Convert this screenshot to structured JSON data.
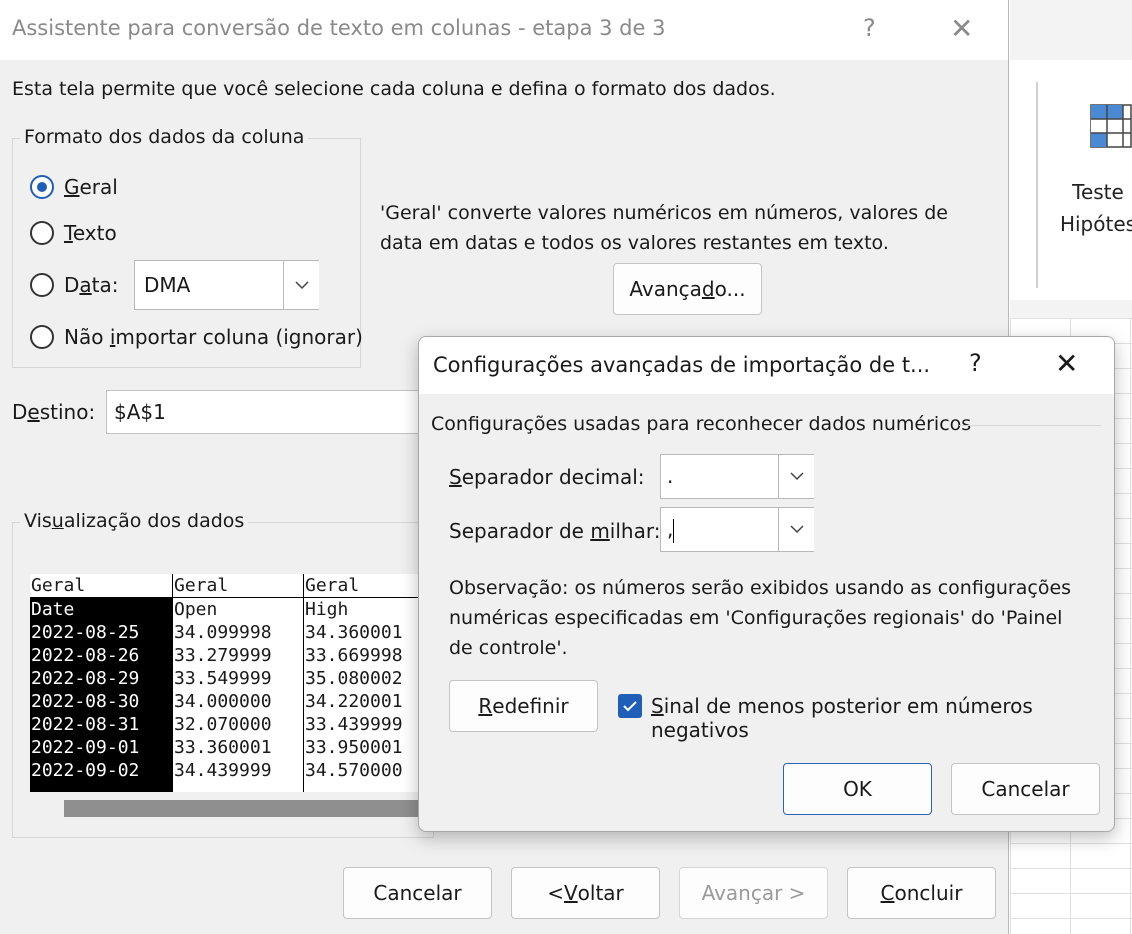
{
  "wizard": {
    "title": "Assistente para conversão de texto em colunas - etapa 3 de 3",
    "help_icon": "?",
    "close_icon": "✕",
    "intro": "Esta tela permite que você selecione cada coluna e defina o formato dos dados.",
    "format_group": {
      "legend": "Formato dos dados da coluna",
      "options": {
        "geral": {
          "pre": "",
          "mn": "G",
          "post": "eral",
          "checked": true
        },
        "texto": {
          "pre": "",
          "mn": "T",
          "post": "exto",
          "checked": false
        },
        "data": {
          "pre": "D",
          "mn": "a",
          "post": "ta:",
          "checked": false
        },
        "ignore": {
          "pre": "Não ",
          "mn": "i",
          "post": "mportar coluna (ignorar)",
          "checked": false
        }
      },
      "date_combo_value": "DMA"
    },
    "description": "'Geral' converte valores numéricos em números, valores de data em datas e todos os valores restantes em texto.",
    "advanced_button": {
      "pre": "Avança",
      "mn": "d",
      "post": "o..."
    },
    "destination": {
      "pre": "D",
      "mn": "e",
      "post": "stino:",
      "value": "$A$1"
    },
    "preview": {
      "legend_pre": "Vis",
      "legend_mn": "u",
      "legend_post": "alização dos dados",
      "columns": [
        {
          "header": "Geral",
          "cells": [
            "Date",
            "2022-08-25",
            "2022-08-26",
            "2022-08-29",
            "2022-08-30",
            "2022-08-31",
            "2022-09-01",
            "2022-09-02"
          ]
        },
        {
          "header": "Geral",
          "cells": [
            "Open",
            "34.099998",
            "33.279999",
            "33.549999",
            "34.000000",
            "32.070000",
            "33.360001",
            "34.439999"
          ]
        },
        {
          "header": "Geral",
          "cells": [
            "High",
            "34.360001",
            "33.669998",
            "35.080002",
            "34.220001",
            "33.439999",
            "33.950001",
            "34.570000"
          ]
        }
      ]
    },
    "buttons": {
      "cancel": "Cancelar",
      "back": {
        "pre": "< ",
        "mn": "V",
        "post": "oltar"
      },
      "next": "Avançar >",
      "finish": {
        "pre": "",
        "mn": "C",
        "post": "oncluir"
      }
    }
  },
  "advanced_dialog": {
    "title": "Configurações avançadas de importação de t...",
    "help_icon": "?",
    "close_icon": "✕",
    "section": "Configurações usadas para reconhecer dados numéricos",
    "decimal": {
      "pre": "",
      "mn": "S",
      "post": "eparador decimal:",
      "value": "."
    },
    "thousands": {
      "pre": "Separador de ",
      "mn": "m",
      "post": "ilhar:",
      "value": ","
    },
    "note": "Observação: os números serão exibidos usando as configurações numéricas especificadas em 'Configurações regionais' do 'Painel de controle'.",
    "reset_button": {
      "pre": "",
      "mn": "R",
      "post": "edefinir"
    },
    "trailing_minus": {
      "pre": "",
      "mn": "S",
      "post": "inal de menos posterior em números negativos",
      "checked": true
    },
    "ok": "OK",
    "cancel": "Cancelar"
  },
  "excel": {
    "whatif_label_1": "Teste",
    "whatif_label_2": "Hipótes"
  },
  "colors": {
    "accent": "#1f5fb8",
    "selected_column_bg": "#000000"
  }
}
